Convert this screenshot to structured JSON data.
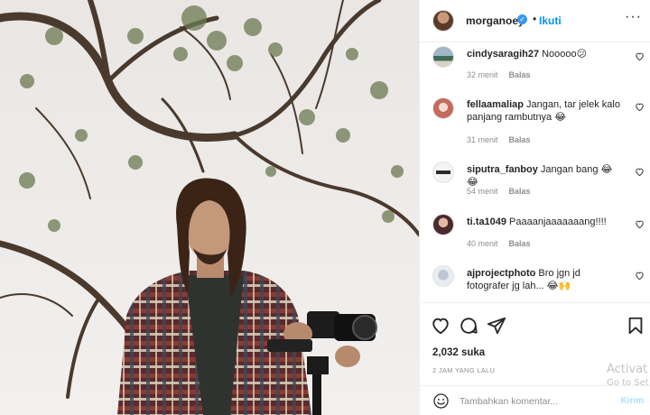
{
  "post": {
    "username": "morganoey",
    "follow_label": "Ikuti",
    "separator": "•",
    "more_label": "···",
    "likes": "2,032 suka",
    "time_ago": "2 JAM YANG LALU",
    "photo_icon": "photo-of-man-with-camera",
    "verified_icon": "verified-badge-icon"
  },
  "comments": [
    {
      "username": "cindysaragih27",
      "text": "Nooooo😕",
      "time": "32 menit",
      "reply": "Balas"
    },
    {
      "username": "fellaamaliap",
      "text": "Jangan, tar jelek kalo panjang rambutnya 😂",
      "time": "31 menit",
      "reply": "Balas"
    },
    {
      "username": "siputra_fanboy",
      "text": "Jangan bang 😂😂",
      "time": "54 menit",
      "reply": "Balas"
    },
    {
      "username": "ti.ta1049",
      "text": "Paaaanjaaaaaaang!!!!",
      "time": "40 menit",
      "reply": "Balas"
    },
    {
      "username": "ajprojectphoto",
      "text": "Bro jgn jd fotografer jg lah... 😂🙌",
      "time": "",
      "reply": ""
    }
  ],
  "add_comment": {
    "placeholder": "Tambahkan komentar...",
    "post_label": "Kirim"
  },
  "watermark": {
    "line1": "Activat",
    "line2": "Go to Set"
  },
  "colors": {
    "link_blue": "#0095f6",
    "post_disabled": "#b2dffc",
    "meta_gray": "#8e8e8e",
    "text_dark": "#262626"
  }
}
